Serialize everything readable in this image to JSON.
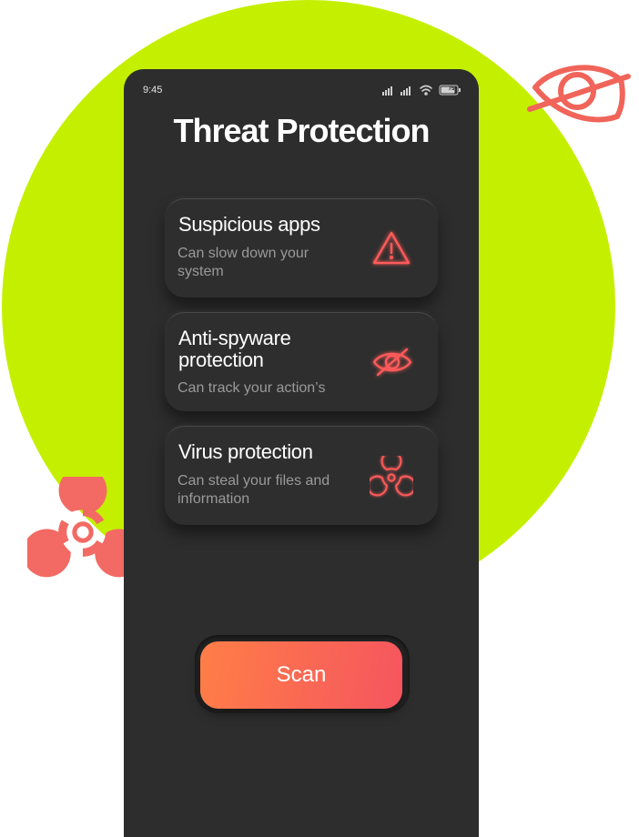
{
  "status_bar": {
    "time": "9:45",
    "battery": "75"
  },
  "title": "Threat Protection",
  "cards": [
    {
      "title": "Suspicious apps",
      "description": "Can slow down your system",
      "icon": "warning-triangle-icon"
    },
    {
      "title": "Anti-spyware protection",
      "description": "Can track your action’s",
      "icon": "eye-off-icon"
    },
    {
      "title": "Virus protection",
      "description": "Can steal your files and information",
      "icon": "biohazard-icon"
    }
  ],
  "scan_button": {
    "label": "Scan"
  },
  "colors": {
    "accent_green": "#c4f000",
    "phone_bg": "#2d2d2d",
    "icon_red": "#ff5a5a",
    "button_gradient_start": "#ff7e47",
    "button_gradient_end": "#f5555f"
  }
}
